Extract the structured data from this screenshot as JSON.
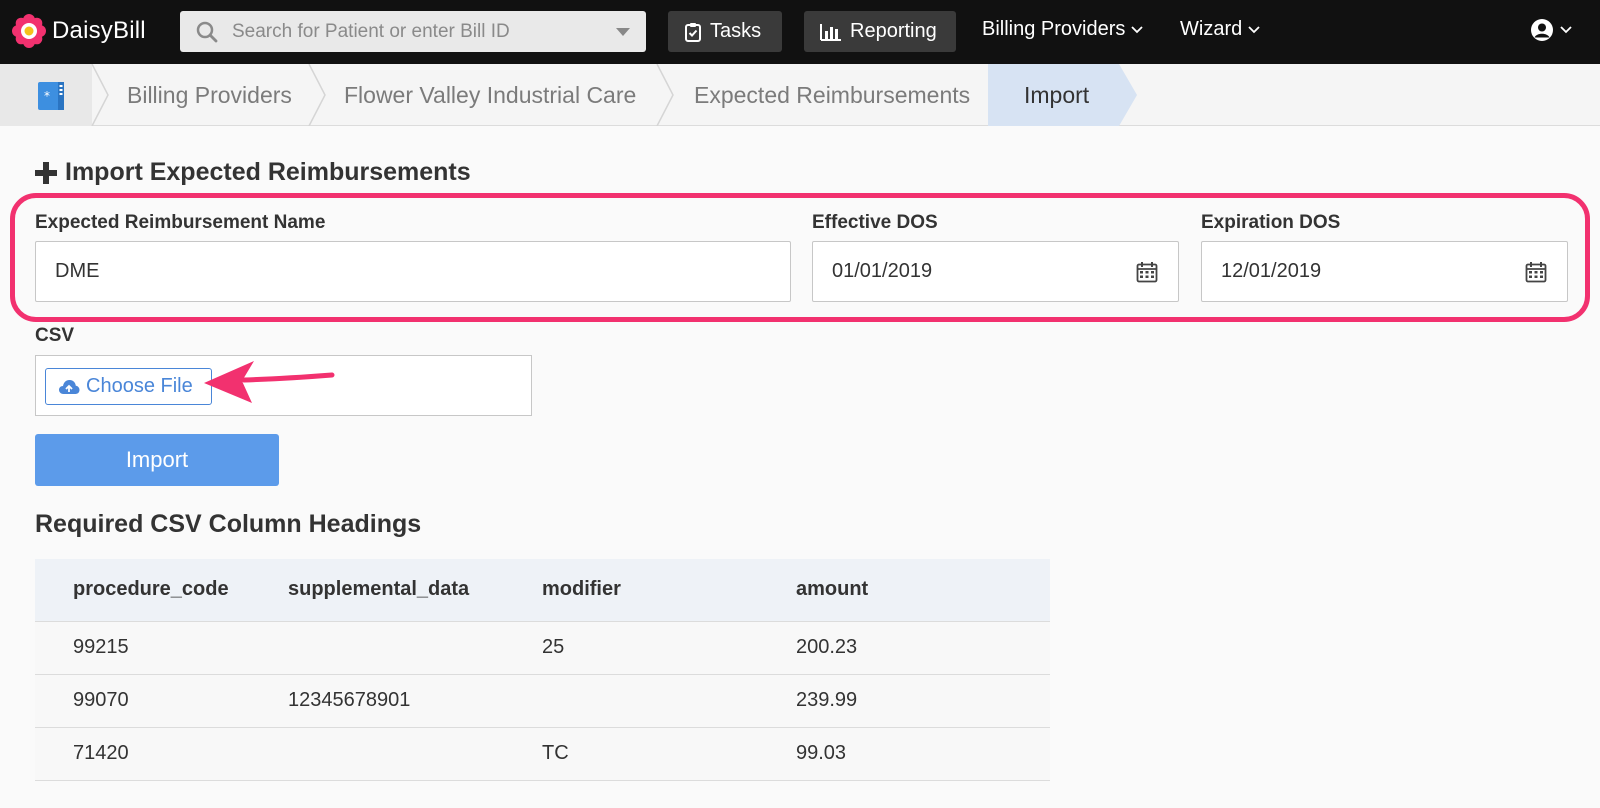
{
  "app": {
    "name": "DaisyBill",
    "brand_color": "#f2316f"
  },
  "topnav": {
    "search_placeholder": "Search for Patient or enter Bill ID",
    "tasks_label": "Tasks",
    "reporting_label": "Reporting",
    "billing_providers_label": "Billing Providers",
    "wizard_label": "Wizard"
  },
  "breadcrumb": {
    "items": [
      "Billing Providers",
      "Flower Valley Industrial Care",
      "Expected Reimbursements"
    ],
    "active": "Import"
  },
  "form": {
    "title": "Import Expected Reimbursements",
    "name_label": "Expected Reimbursement Name",
    "name_value": "DME",
    "effective_label": "Effective DOS",
    "effective_value": "01/01/2019",
    "expiration_label": "Expiration DOS",
    "expiration_value": "12/01/2019",
    "csv_label": "CSV",
    "choose_file_label": "Choose File",
    "import_label": "Import"
  },
  "csv_headings": {
    "title": "Required CSV Column Headings",
    "columns": [
      "procedure_code",
      "supplemental_data",
      "modifier",
      "amount"
    ],
    "rows": [
      [
        "99215",
        "",
        "25",
        "200.23"
      ],
      [
        "99070",
        "12345678901",
        "",
        "239.99"
      ],
      [
        "71420",
        "",
        "TC",
        "99.03"
      ]
    ]
  },
  "colors": {
    "topnav_bg": "#111111",
    "accent_blue": "#5c9bea",
    "highlight": "#f2316f"
  },
  "icons": [
    "daisy-logo-icon",
    "search-icon",
    "clipboard-check-icon",
    "bar-chart-icon",
    "chevron-down-icon",
    "user-circle-icon",
    "medical-binder-icon",
    "plus-icon",
    "calendar-icon",
    "cloud-upload-icon",
    "arrow-pointer-icon"
  ]
}
